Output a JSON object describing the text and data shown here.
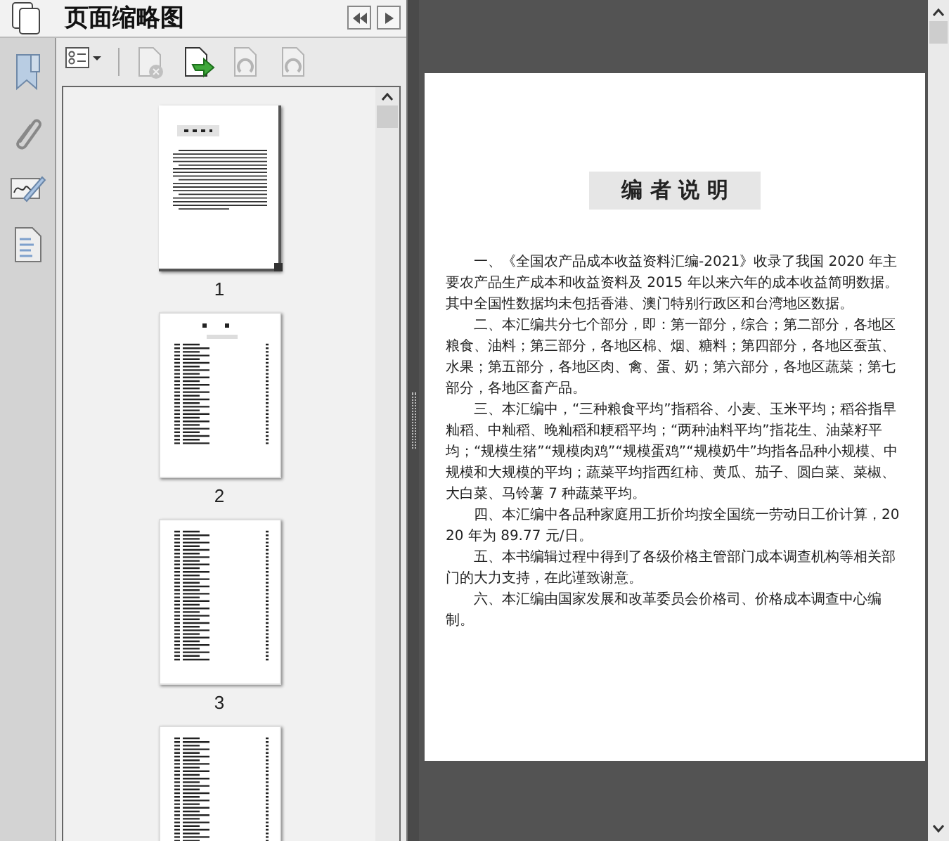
{
  "panel": {
    "title": "页面缩略图"
  },
  "toolbar": [
    {
      "kind": "options",
      "disabled": false
    },
    {
      "kind": "delete",
      "disabled": true
    },
    {
      "kind": "insert",
      "disabled": false
    },
    {
      "kind": "rotate-left",
      "disabled": true
    },
    {
      "kind": "rotate-right",
      "disabled": true
    }
  ],
  "thumbnails": [
    {
      "kind": "preface",
      "label": "1",
      "selected": true
    },
    {
      "kind": "contents",
      "label": "2",
      "selected": false
    },
    {
      "kind": "list",
      "label": "3",
      "selected": false
    },
    {
      "kind": "list",
      "selected": false
    }
  ],
  "document": {
    "heading": "编 者 说 明",
    "paragraphs": [
      "一、《全国农产品成本收益资料汇编-2021》收录了我国 2020 年主要农产品生产成本和收益资料及 2015 年以来六年的成本收益简明数据。其中全国性数据均未包括香港、澳门特别行政区和台湾地区数据。",
      "二、本汇编共分七个部分，即：第一部分，综合；第二部分，各地区粮食、油料；第三部分，各地区棉、烟、糖料；第四部分，各地区蚕茧、水果；第五部分，各地区肉、禽、蛋、奶；第六部分，各地区蔬菜；第七部分，各地区畜产品。",
      "三、本汇编中，“三种粮食平均”指稻谷、小麦、玉米平均；稻谷指早籼稻、中籼稻、晚籼稻和粳稻平均；“两种油料平均”指花生、油菜籽平均；“规模生猪”“规模肉鸡”“规模蛋鸡”“规模奶牛”均指各品种小规模、中规模和大规模的平均；蔬菜平均指西红柿、黄瓜、茄子、圆白菜、菜椒、大白菜、马铃薯 7 种蔬菜平均。",
      "四、本汇编中各品种家庭用工折价均按全国统一劳动日工价计算，2020 年为 89.77 元/日。",
      "五、本书编辑过程中得到了各级价格主管部门成本调查机构等相关部门的大力支持，在此谨致谢意。",
      "六、本汇编由国家发展和改革委员会价格司、价格成本调查中心编制。"
    ]
  }
}
